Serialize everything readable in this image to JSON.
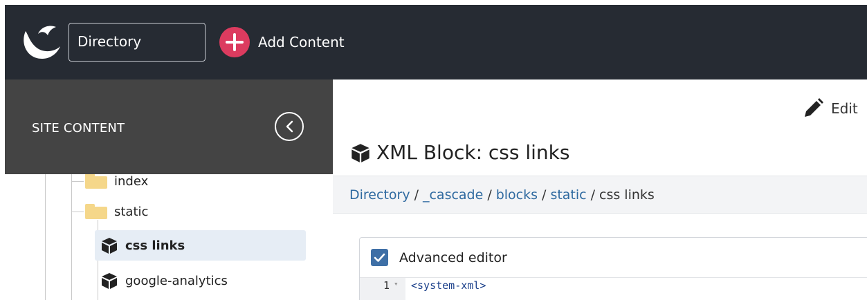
{
  "header": {
    "site_selector": "Directory",
    "add_content_label": "Add Content"
  },
  "sidebar": {
    "title": "SITE CONTENT",
    "tree": [
      {
        "label": "index",
        "type": "folder"
      },
      {
        "label": "static",
        "type": "folder"
      },
      {
        "label": "css links",
        "type": "block",
        "selected": true
      },
      {
        "label": "google-analytics",
        "type": "block"
      }
    ]
  },
  "main": {
    "edit_label": "Edit",
    "title": "XML Block: css links",
    "breadcrumb": [
      {
        "label": "Directory",
        "link": true
      },
      {
        "label": "_cascade",
        "link": true
      },
      {
        "label": "blocks",
        "link": true
      },
      {
        "label": "static",
        "link": true
      },
      {
        "label": "css links",
        "link": false
      }
    ],
    "breadcrumb_separator": "/",
    "editor": {
      "advanced_label": "Advanced editor",
      "advanced_checked": true,
      "lines": [
        {
          "number": "1",
          "text": "<system-xml>"
        }
      ]
    }
  },
  "colors": {
    "topbar": "#262b33",
    "sidebar_header": "#444444",
    "add_button": "#dc3b5f",
    "link": "#2f6aa0",
    "checkbox": "#3e6fa6",
    "folder": "#f5d78a",
    "selected_item": "#e6edf5"
  },
  "icons": {
    "logo": "crescent-logo-icon",
    "add": "plus-circle-icon",
    "collapse": "chevron-left-circle-icon",
    "edit": "pencil-icon",
    "block": "cube-icon",
    "folder": "folder-icon",
    "checkbox": "checkmark-icon"
  }
}
